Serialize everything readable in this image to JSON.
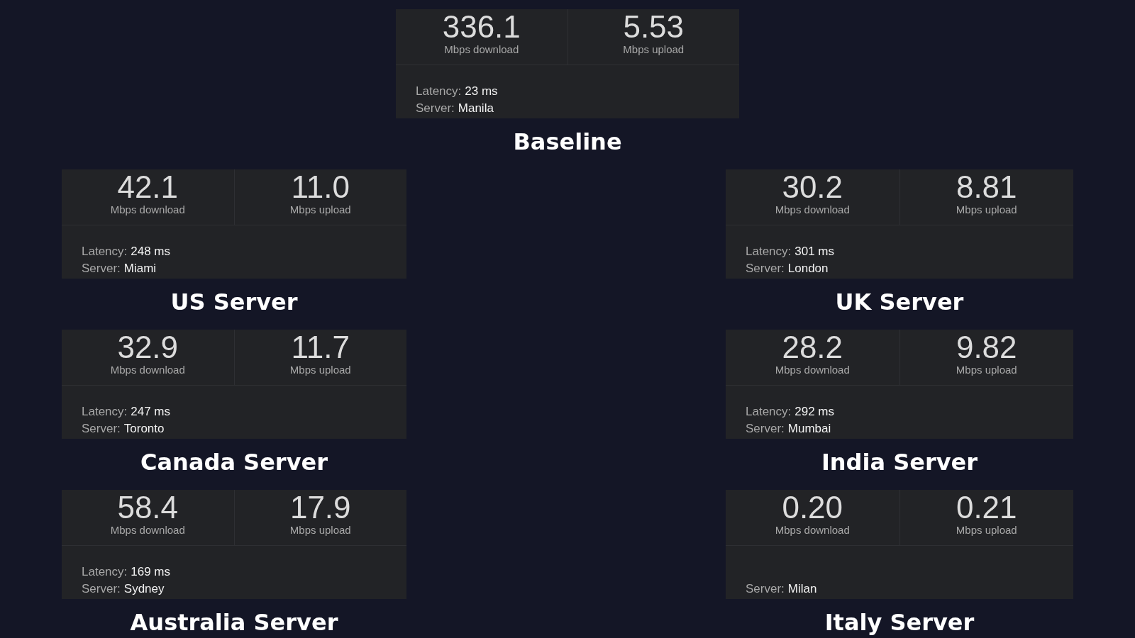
{
  "results": [
    {
      "title": "Baseline",
      "download": {
        "value": "336.1",
        "unit": "Mbps download"
      },
      "upload": {
        "value": "5.53",
        "unit": "Mbps upload"
      },
      "latency": {
        "label": "Latency:",
        "value": "23 ms"
      },
      "server": {
        "label": "Server:",
        "value": "Manila"
      }
    },
    {
      "title": "US Server",
      "download": {
        "value": "42.1",
        "unit": "Mbps download"
      },
      "upload": {
        "value": "11.0",
        "unit": "Mbps upload"
      },
      "latency": {
        "label": "Latency:",
        "value": "248 ms"
      },
      "server": {
        "label": "Server:",
        "value": "Miami"
      }
    },
    {
      "title": "UK Server",
      "download": {
        "value": "30.2",
        "unit": "Mbps download"
      },
      "upload": {
        "value": "8.81",
        "unit": "Mbps upload"
      },
      "latency": {
        "label": "Latency:",
        "value": "301 ms"
      },
      "server": {
        "label": "Server:",
        "value": "London"
      }
    },
    {
      "title": "Canada Server",
      "download": {
        "value": "32.9",
        "unit": "Mbps download"
      },
      "upload": {
        "value": "11.7",
        "unit": "Mbps upload"
      },
      "latency": {
        "label": "Latency:",
        "value": "247 ms"
      },
      "server": {
        "label": "Server:",
        "value": "Toronto"
      }
    },
    {
      "title": "India Server",
      "download": {
        "value": "28.2",
        "unit": "Mbps download"
      },
      "upload": {
        "value": "9.82",
        "unit": "Mbps upload"
      },
      "latency": {
        "label": "Latency:",
        "value": "292 ms"
      },
      "server": {
        "label": "Server:",
        "value": "Mumbai"
      }
    },
    {
      "title": "Australia Server",
      "download": {
        "value": "58.4",
        "unit": "Mbps download"
      },
      "upload": {
        "value": "17.9",
        "unit": "Mbps upload"
      },
      "latency": {
        "label": "Latency:",
        "value": "169 ms"
      },
      "server": {
        "label": "Server:",
        "value": "Sydney"
      }
    },
    {
      "title": "Italy Server",
      "download": {
        "value": "0.20",
        "unit": "Mbps download"
      },
      "upload": {
        "value": "0.21",
        "unit": "Mbps upload"
      },
      "server": {
        "label": "Server:",
        "value": "Milan"
      }
    }
  ]
}
